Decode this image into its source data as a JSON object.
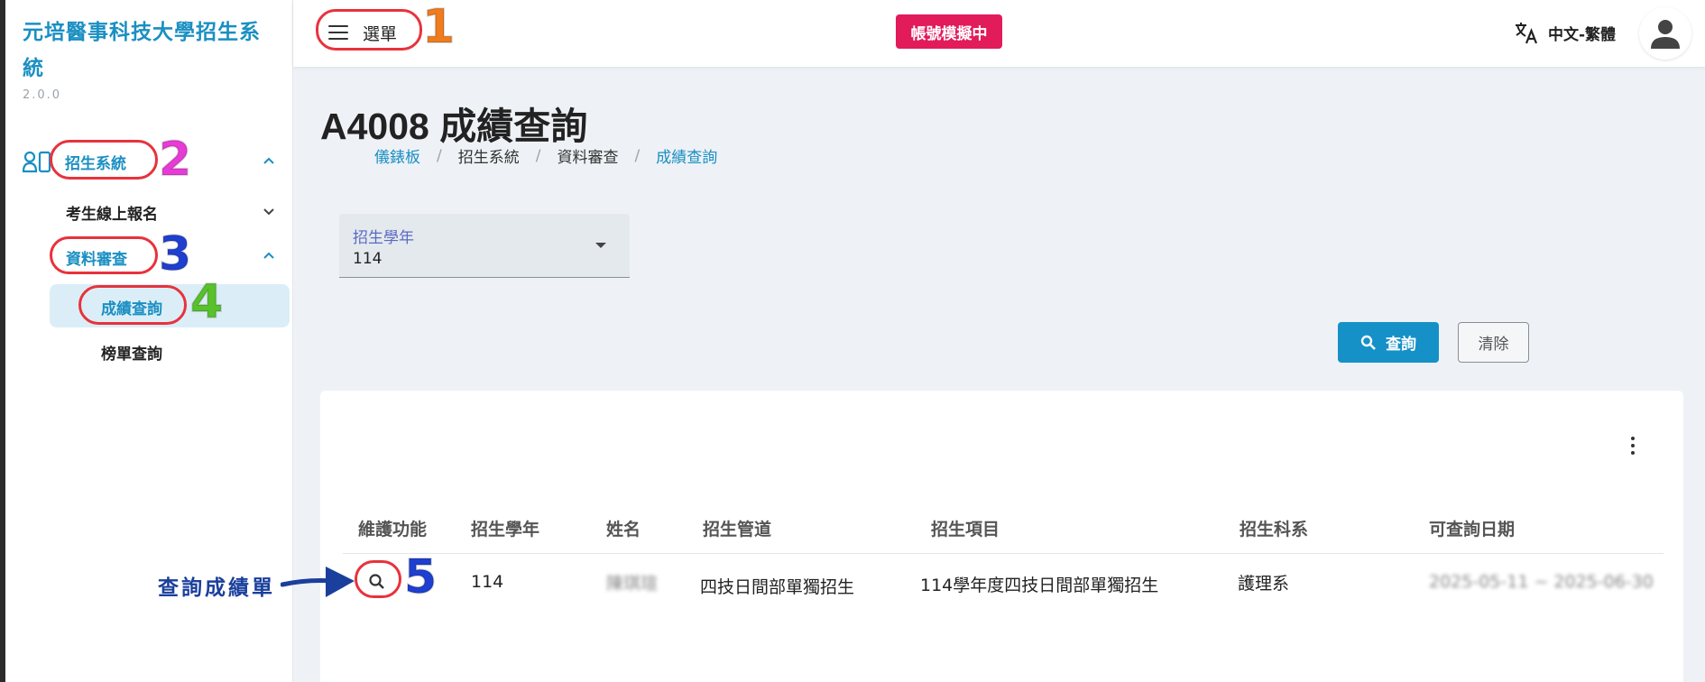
{
  "sidebar": {
    "brand_title": "元培醫事科技大學招生系統",
    "version": "2.0.0",
    "group_admissions": "招生系統",
    "sub_online_registration": "考生線上報名",
    "sub_data_review": "資料審查",
    "leaf_score_query": "成績查詢",
    "leaf_ranking_query": "榜單查詢"
  },
  "topbar": {
    "menu_label": "選單",
    "impersonation_badge": "帳號模擬中",
    "language": "中文-繁體"
  },
  "page": {
    "title": "A4008 成績查詢",
    "breadcrumb": [
      "儀錶板",
      "招生系統",
      "資料審查",
      "成績查詢"
    ]
  },
  "filter": {
    "year_label": "招生學年",
    "year_value": "114",
    "query_button": "查詢",
    "clear_button": "清除"
  },
  "table": {
    "headers": [
      "維護功能",
      "招生學年",
      "姓名",
      "招生管道",
      "招生項目",
      "招生科系",
      "可查詢日期"
    ],
    "rows": [
      {
        "year": "114",
        "name": "陳琪瑄",
        "channel": "四技日間部單獨招生",
        "item": "114學年度四技日間部單獨招生",
        "department": "護理系",
        "query_dates": "2025-05-11 ~ 2025-06-30"
      }
    ]
  },
  "annotations": {
    "step1": "1",
    "step2": "2",
    "step3": "3",
    "step4": "4",
    "step5": "5",
    "caption": "查詢成績單"
  },
  "colors": {
    "accent": "#1a8fc2",
    "badge": "#e21b5a",
    "annotation_red": "#e8323c"
  }
}
